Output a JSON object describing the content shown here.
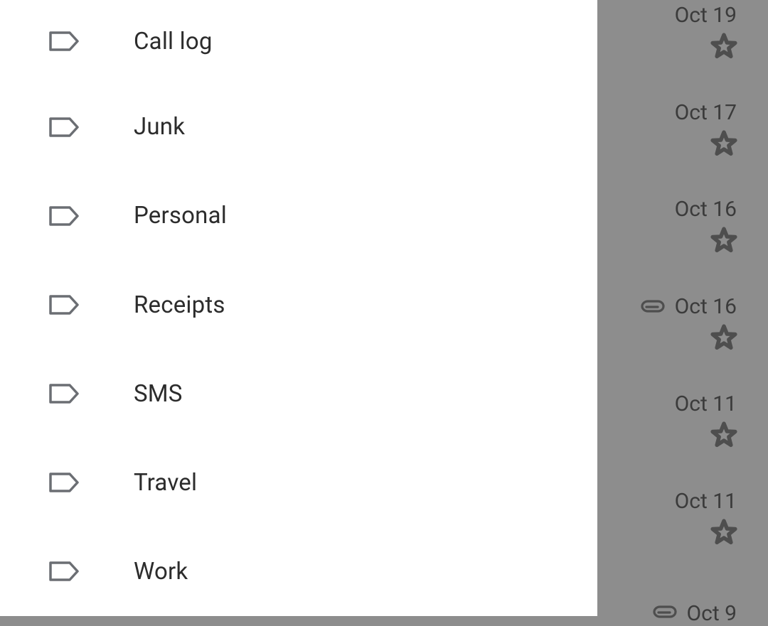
{
  "sidebar": {
    "items": [
      {
        "label": "Call log"
      },
      {
        "label": "Junk"
      },
      {
        "label": "Personal"
      },
      {
        "label": "Receipts"
      },
      {
        "label": "SMS"
      },
      {
        "label": "Travel"
      },
      {
        "label": "Work"
      }
    ]
  },
  "mail_list": {
    "rows": [
      {
        "date": "Oct 19",
        "has_attachment": false
      },
      {
        "date": "Oct 17",
        "has_attachment": false
      },
      {
        "date": "Oct 16",
        "has_attachment": false
      },
      {
        "date": "Oct 16",
        "has_attachment": true
      },
      {
        "date": "Oct 11",
        "has_attachment": false
      },
      {
        "date": "Oct 11",
        "has_attachment": false
      }
    ],
    "peek_row": {
      "date": "Oct 9",
      "has_attachment": true
    }
  }
}
